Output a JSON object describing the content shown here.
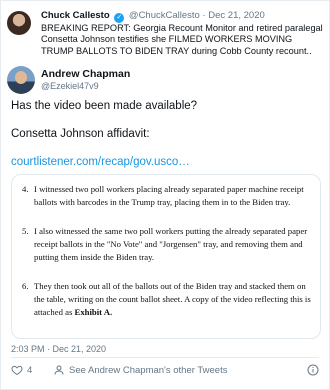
{
  "quoted": {
    "name": "Chuck Callesto",
    "handle": "@ChuckCallesto",
    "date": "· Dec 21, 2020",
    "text": "BREAKING REPORT: Georgia Recount Monitor and retired paralegal Consetta Johnson testifies she FILMED WORKERS MOVING TRUMP BALLOTS TO BIDEN TRAY during Cobb County recount.."
  },
  "author": {
    "name": "Andrew Chapman",
    "handle": "@Ezekiel47v9"
  },
  "tweet": {
    "line1": "Has the video been made available?",
    "line2": "Consetta Johnson affidavit:",
    "link": "courtlistener.com/recap/gov.usco…"
  },
  "document": {
    "paragraphs": [
      {
        "num": "4.",
        "text": "I witnessed two poll workers placing already separated paper machine receipt ballots with barcodes in the Trump tray, placing them in to the Biden tray."
      },
      {
        "num": "5.",
        "text": "I also witnessed the same two poll workers putting the already separated paper receipt ballots in the \"No Vote\" and \"Jorgensen\" tray, and removing them and putting them inside the Biden tray."
      },
      {
        "num": "6.",
        "text": "They then took out all of the ballots out of the Biden tray and stacked them on the table, writing on the count ballot sheet. A copy of the video reflecting this is attached as",
        "tail": "Exhibit A."
      }
    ]
  },
  "meta": {
    "time": "2:03 PM · Dec 21, 2020"
  },
  "actions": {
    "likes": "4",
    "see_more": "See Andrew Chapman's other Tweets"
  },
  "colors": {
    "accent": "#1da1f2",
    "link": "#1b95e0",
    "muted": "#657786"
  }
}
